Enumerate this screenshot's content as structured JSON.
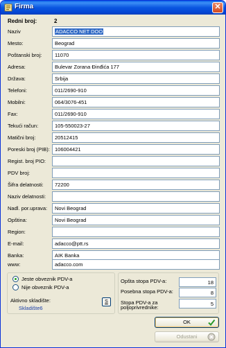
{
  "window": {
    "title": "Firma",
    "close_glyph": "✕"
  },
  "header": {
    "label": "Redni broj:",
    "value": "2"
  },
  "fields": [
    {
      "label": "Naziv",
      "value": "ADACCO NET DOO",
      "selected": true
    },
    {
      "label": "Mesto:",
      "value": "Beograd"
    },
    {
      "label": "Poštanski broj:",
      "value": "11070"
    },
    {
      "label": "Adresa:",
      "value": "Bulevar Zorana Đinđića 177"
    },
    {
      "label": "Država:",
      "value": "Srbija"
    },
    {
      "label": "Telefoni:",
      "value": "011/2690-910"
    },
    {
      "label": "Mobilni:",
      "value": "064/3076-451"
    },
    {
      "label": "Fax:",
      "value": "011/2690-910"
    },
    {
      "label": "Tekući račun:",
      "value": "105-550023-27"
    },
    {
      "label": "Matični broj:",
      "value": "20512415"
    },
    {
      "label": "Poreski broj (PIB):",
      "value": "106004421"
    },
    {
      "label": "Regist. broj PIO:",
      "value": ""
    },
    {
      "label": "PDV broj:",
      "value": ""
    },
    {
      "label": "Šifra delatnosti:",
      "value": "72200"
    },
    {
      "label": "Naziv delatnosti:",
      "value": ""
    },
    {
      "label": "Nadl. por.uprava:",
      "value": "Novi Beograd"
    },
    {
      "label": "Opština:",
      "value": "Novi Beograd"
    },
    {
      "label": "Region:",
      "value": ""
    },
    {
      "label": "E-mail:",
      "value": "adacco@ptt.rs"
    },
    {
      "label": "Banka:",
      "value": "AIK Banka"
    },
    {
      "label": "www:",
      "value": "adacco.com"
    }
  ],
  "pdv_status": {
    "options": [
      {
        "label": "Jeste obveznik PDV-a",
        "checked": true
      },
      {
        "label": "Nije obveznik PDV-a",
        "checked": false
      }
    ]
  },
  "warehouse": {
    "label": "Aktivno skladište:",
    "value": "Skladište6",
    "button_label": "S"
  },
  "pdv_rates": [
    {
      "label": "Opšta stopa PDV-a:",
      "value": "18"
    },
    {
      "label": "Posebna stopa PDV-a:",
      "value": "8"
    },
    {
      "label": "Stopa PDV-a za\npoljoprivrednike:",
      "value": "5"
    }
  ],
  "buttons": {
    "ok": "OK",
    "cancel": "Odustani"
  },
  "colors": {
    "titlebar": "#0a56e0",
    "selection": "#316ac5",
    "link": "#1a3ea8"
  }
}
